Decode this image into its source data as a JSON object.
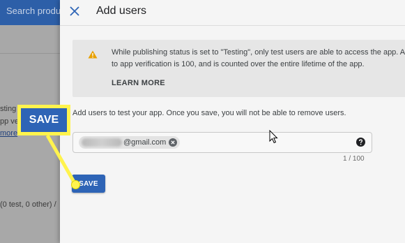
{
  "background": {
    "search_placeholder": "Search produ",
    "snippets": [
      "sting",
      "pp ve",
      "more",
      "(0 test, 0 other) /"
    ]
  },
  "panel": {
    "title": "Add users",
    "alert": {
      "line1": "While publishing status is set to \"Testing\", only test users are able to access the app. All",
      "line2": "to app verification is 100, and is counted over the entire lifetime of the app.",
      "learn_more": "LEARN MORE"
    },
    "instructions": "Add users to test your app. Once you save, you will not be able to remove users.",
    "user_input": {
      "chip_email": "@gmail.com",
      "count": "1 / 100"
    },
    "save_label": "SAVE"
  },
  "callout": {
    "label": "SAVE"
  },
  "colors": {
    "accent": "#2e64b6",
    "highlight": "#fff34d",
    "warning": "#e8a000"
  },
  "icons": [
    "close-icon",
    "warning-icon",
    "chip-remove-icon",
    "help-icon",
    "mouse-cursor-icon"
  ]
}
